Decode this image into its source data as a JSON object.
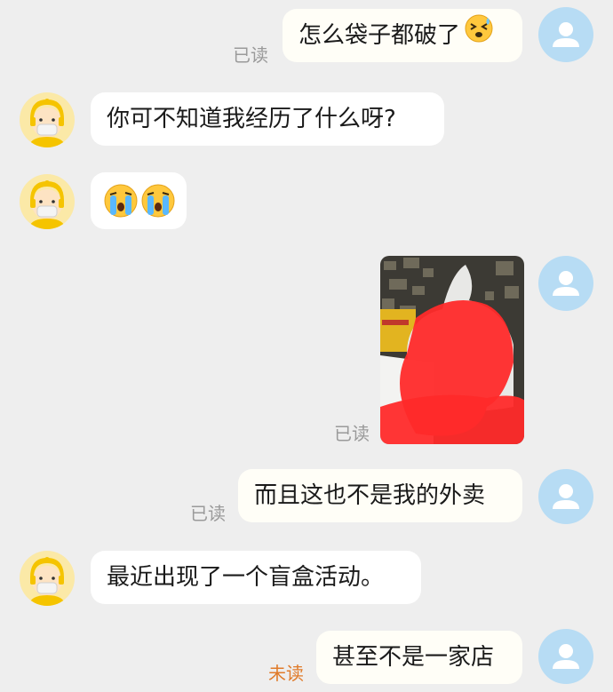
{
  "colors": {
    "background": "#eeeeee",
    "avatar_me": "#b7dcf4",
    "avatar_other": "#fbe9a7",
    "read_status": "#9a9a9a",
    "unread_status": "#e07b2a",
    "redaction": "#ff2a2a"
  },
  "messages": [
    {
      "sender": "me",
      "text": "怎么袋子都破了",
      "status": "已读",
      "icon": "dizzy-sweat-emoji-icon"
    },
    {
      "sender": "other",
      "text": "你可不知道我经历了什么呀?"
    },
    {
      "sender": "other",
      "text": "",
      "icons": [
        "crying-emoji-icon",
        "crying-emoji-icon"
      ]
    },
    {
      "sender": "me",
      "type": "image",
      "status": "已读",
      "image": "photo-of-torn-plastic-bag-redacted"
    },
    {
      "sender": "me",
      "text": "而且这也不是我的外卖",
      "status": "已读"
    },
    {
      "sender": "other",
      "text": "最近出现了一个盲盒活动。"
    },
    {
      "sender": "me",
      "text": "甚至不是一家店",
      "status": "未读"
    }
  ]
}
